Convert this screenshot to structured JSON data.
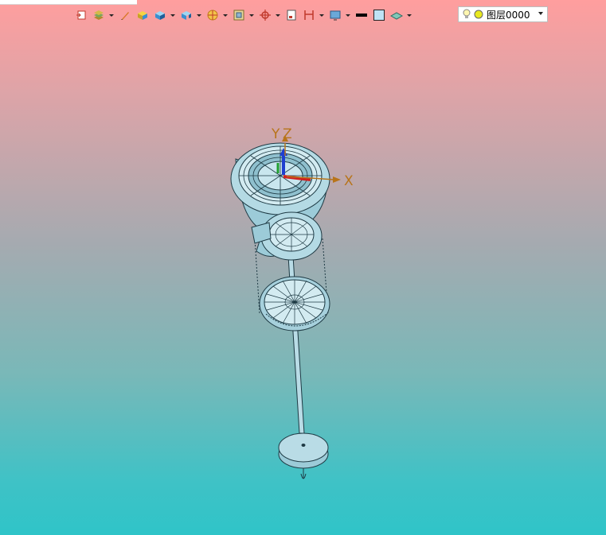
{
  "layer_selector": {
    "value": "图层0000"
  },
  "axes": {
    "x_label": "X",
    "y_label": "Y",
    "z_label": "Z"
  },
  "toolbar_icons": [
    "view-orient-icon",
    "layers-icon",
    "pen-icon",
    "box-yellow-icon",
    "box-blue-icon",
    "box-section-icon",
    "render-style-icon",
    "frame-icon",
    "target-icon",
    "page-icon",
    "measure-icon",
    "display-icon",
    "line-color-icon",
    "fill-color-icon",
    "material-icon"
  ],
  "colors": {
    "background_top": "#ff9e9e",
    "background_bottom": "#2fc4c8",
    "model_fill": "#a9d3df",
    "model_stroke": "#1e3a44",
    "axis_label": "#b8741a"
  }
}
